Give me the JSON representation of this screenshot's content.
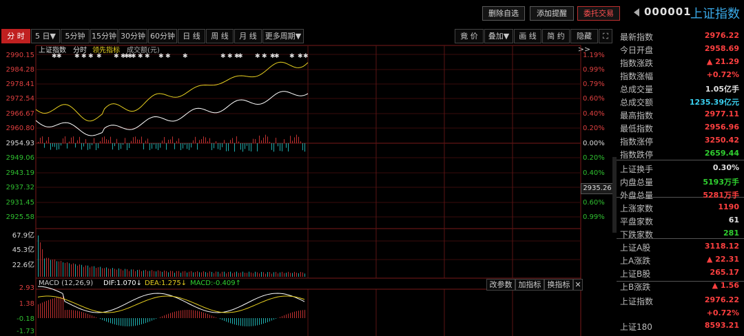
{
  "topbar": {
    "delete_watch": "删除自选",
    "add_alert": "添加提醒",
    "trade": "委托交易",
    "code": "000001",
    "name": "上证指数"
  },
  "tabs": [
    "分 时",
    "5 日▼",
    "5分钟",
    "15分钟",
    "30分钟",
    "60分钟",
    "日 线",
    "周 线",
    "月 线",
    "更多周期▼"
  ],
  "tools": [
    "竟 价",
    "叠加▼",
    "画 线",
    "简 约",
    "隐藏>>"
  ],
  "legend": {
    "index": "上证指数",
    "fenshi": "分时",
    "lead": "领先指标",
    "amount": "成交额(元)"
  },
  "y_left": [
    "2990.15",
    "2984.28",
    "2978.41",
    "2972.54",
    "2966.67",
    "2960.80",
    "2954.93",
    "2949.06",
    "2943.19",
    "2937.32",
    "2931.45",
    "2925.58"
  ],
  "y_right": [
    "1.19%",
    "0.99%",
    "0.79%",
    "0.60%",
    "0.40%",
    "0.20%",
    "0.00%",
    "0.20%",
    "0.40%",
    "0.60%",
    "0.79%",
    "0.99%"
  ],
  "current_tag": "2935.26",
  "vol_labels": [
    "67.9亿",
    "45.3亿",
    "22.6亿"
  ],
  "macd": {
    "label": "MACD (12,26,9)",
    "dif": "DIF:1.070↓",
    "dea": "DEA:1.275↓",
    "macd": "MACD:-0.409↑",
    "y": [
      "2.93",
      "1.38",
      "-0.18",
      "-1.73"
    ],
    "btn_params": "改参数",
    "btn_add": "加指标",
    "btn_swap": "换指标"
  },
  "panel": [
    {
      "label": "最新指数",
      "value": "2976.22",
      "color": "red"
    },
    {
      "label": "今日开盘",
      "value": "2958.69",
      "color": "red"
    },
    {
      "label": "指数涨跌",
      "value": "▲ 21.29",
      "color": "red"
    },
    {
      "label": "指数涨幅",
      "value": "+0.72%",
      "color": "red"
    },
    {
      "label": "总成交量",
      "value": "1.05亿手",
      "color": "white"
    },
    {
      "label": "总成交额",
      "value": "1235.39亿元",
      "color": "cyan"
    },
    {
      "label": "最高指数",
      "value": "2977.11",
      "color": "red"
    },
    {
      "label": "最低指数",
      "value": "2956.96",
      "color": "red"
    },
    {
      "label": "指数涨停",
      "value": "3250.42",
      "color": "red"
    },
    {
      "label": "指数跌停",
      "value": "2659.44",
      "color": "green"
    },
    {
      "label": "上证换手",
      "value": "0.30%",
      "color": "white"
    },
    {
      "label": "内盘总量",
      "value": "5193万手",
      "color": "green"
    },
    {
      "label": "外盘总量",
      "value": "5281万手",
      "color": "red"
    },
    {
      "label": "上涨家数",
      "value": "1190",
      "color": "red"
    },
    {
      "label": "平盘家数",
      "value": "61",
      "color": "white"
    },
    {
      "label": "下跌家数",
      "value": "281",
      "color": "green"
    },
    {
      "label": "上证A股",
      "value": "3118.12",
      "color": "red"
    },
    {
      "label": "上A涨跌",
      "value": "▲ 22.31",
      "color": "red"
    },
    {
      "label": "上证B股",
      "value": "265.17",
      "color": "red"
    },
    {
      "label": "上B涨跌",
      "value": "▲ 1.56",
      "color": "red"
    },
    {
      "label": "上证指数",
      "value": "2976.22",
      "color": "red"
    },
    {
      "label": "",
      "value": "+0.72%",
      "color": "red"
    },
    {
      "label": "上证180",
      "value": "8593.21",
      "color": "red"
    }
  ],
  "colors": {
    "up": "#ff4040",
    "down": "#30d030",
    "price": "#ffffff",
    "lead": "#e8d020",
    "bg": "#000000"
  }
}
